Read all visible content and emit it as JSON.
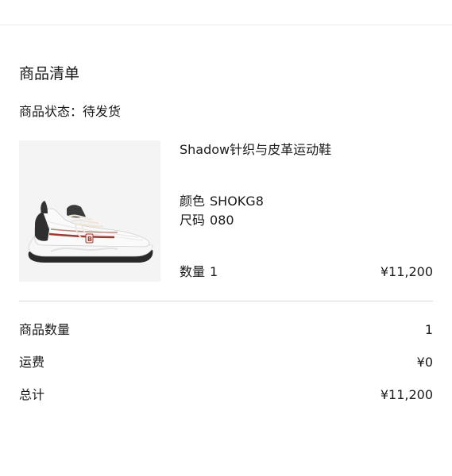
{
  "section_title": "商品清单",
  "order_status": {
    "label": "商品状态：",
    "value": "待发货"
  },
  "product": {
    "image_icon": "sneaker-product-image",
    "name": "Shadow针织与皮革运动鞋",
    "color_label": "颜色",
    "color_value": "SHOKG8",
    "size_label": "尺码",
    "size_value": "080",
    "quantity_label": "数量",
    "quantity_value": "1",
    "price": "¥11,200"
  },
  "summary": {
    "item_count_label": "商品数量",
    "item_count_value": "1",
    "shipping_label": "运费",
    "shipping_value": "¥0",
    "total_label": "总计",
    "total_value": "¥11,200"
  },
  "colors": {
    "text": "#1a1a1a",
    "divider": "#d9d9d9",
    "image_background": "#f4f4f4"
  }
}
